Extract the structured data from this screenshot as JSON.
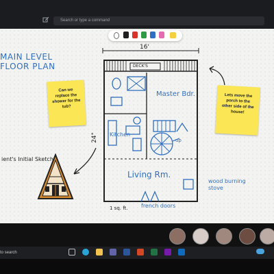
{
  "top_bar": {
    "search_placeholder": "Search or type a command"
  },
  "canvas": {
    "title_lines": [
      "MAIN LEVEL",
      "FLOOR PLAN"
    ],
    "sticky_left": "Can we replace the shower for the tub?",
    "sticky_right": "Lets move the porch to the other side of the house!",
    "sketch_caption": "ient's Initial Sketch",
    "plan_labels": {
      "deck": "DECK'S",
      "width": "16'",
      "height": "24\"",
      "master": "Master Bdr.",
      "kitchen": "Kitchen",
      "living": "Living Rm.",
      "up": "up",
      "stove": "wood burning stove",
      "doors": "french doors",
      "scale": "1 sq. ft."
    }
  },
  "toolbar_tools": [
    {
      "name": "lasso",
      "color": "#6b6b6b"
    },
    {
      "name": "pen-black",
      "color": "#1f1f1f"
    },
    {
      "name": "pen-red",
      "color": "#d9342b"
    },
    {
      "name": "pen-green",
      "color": "#2f9b45"
    },
    {
      "name": "pen-blue",
      "color": "#2f6fc1"
    },
    {
      "name": "highlighter-pink",
      "color": "#e56bb0"
    },
    {
      "name": "sticky-note",
      "color": "#f4d03f"
    }
  ],
  "call_participants": [
    {
      "name": "participant-1",
      "color": "#8d6e63"
    },
    {
      "name": "participant-2",
      "color": "#d7ccc8"
    },
    {
      "name": "participant-3",
      "color": "#a1887f"
    },
    {
      "name": "participant-4",
      "color": "#6d4c41"
    },
    {
      "name": "participant-5",
      "color": "#bcaaa4"
    }
  ],
  "taskbar": {
    "search_label": "to search"
  }
}
